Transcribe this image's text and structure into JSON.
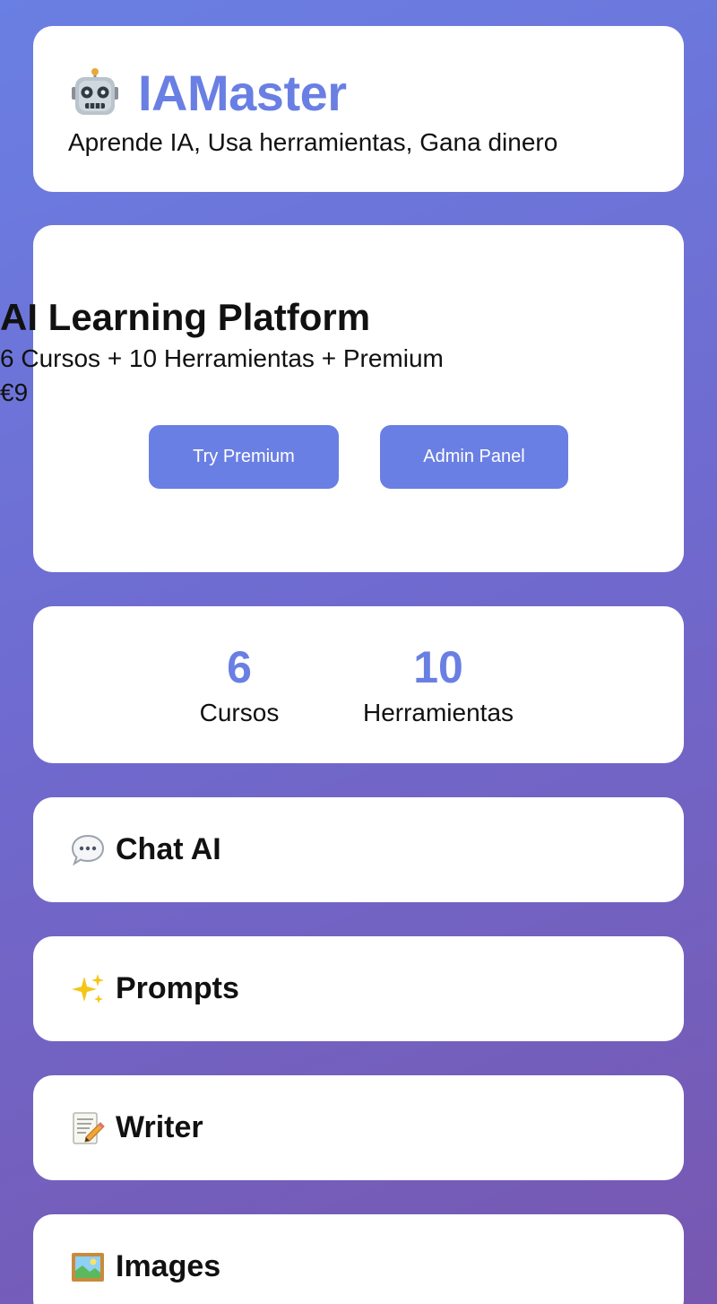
{
  "header": {
    "icon": "robot-icon",
    "title": "IAMaster",
    "tagline": "Aprende IA, Usa herramientas, Gana dinero"
  },
  "hero": {
    "title": "AI Learning Platform",
    "subtitle": "6 Cursos + 10 Herramientas + Premium",
    "price": "€9",
    "try_button": "Try Premium",
    "admin_button": "Admin Panel"
  },
  "stats": [
    {
      "value": "6",
      "label": "Cursos"
    },
    {
      "value": "10",
      "label": "Herramientas"
    }
  ],
  "tools": [
    {
      "icon": "speech-bubble-icon",
      "label": "Chat AI"
    },
    {
      "icon": "sparkles-icon",
      "label": "Prompts"
    },
    {
      "icon": "memo-pencil-icon",
      "label": "Writer"
    },
    {
      "icon": "framed-picture-icon",
      "label": "Images"
    }
  ],
  "colors": {
    "accent": "#6a7fe3",
    "background_start": "#6a7fe3",
    "background_end": "#7757b0",
    "card": "#ffffff",
    "text": "#111111"
  }
}
